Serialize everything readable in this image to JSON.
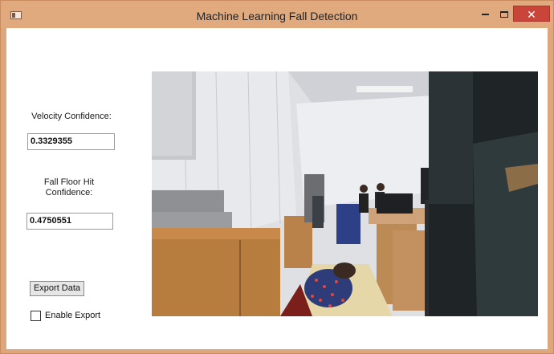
{
  "window": {
    "title": "Machine Learning Fall Detection",
    "icons": {
      "app": "window-app-icon",
      "minimize": "minimize-icon",
      "maximize": "maximize-icon",
      "close": "close-icon"
    },
    "colors": {
      "titlebar": "#e0a97e",
      "close": "#c9453a"
    }
  },
  "panel": {
    "velocity_label": "Velocity Confidence:",
    "velocity_value": "0.3329355",
    "floor_label_line1": "Fall Floor Hit",
    "floor_label_line2": "Confidence:",
    "floor_value": "0.4750551",
    "export_button": "Export Data",
    "enable_export_label": "Enable Export"
  }
}
